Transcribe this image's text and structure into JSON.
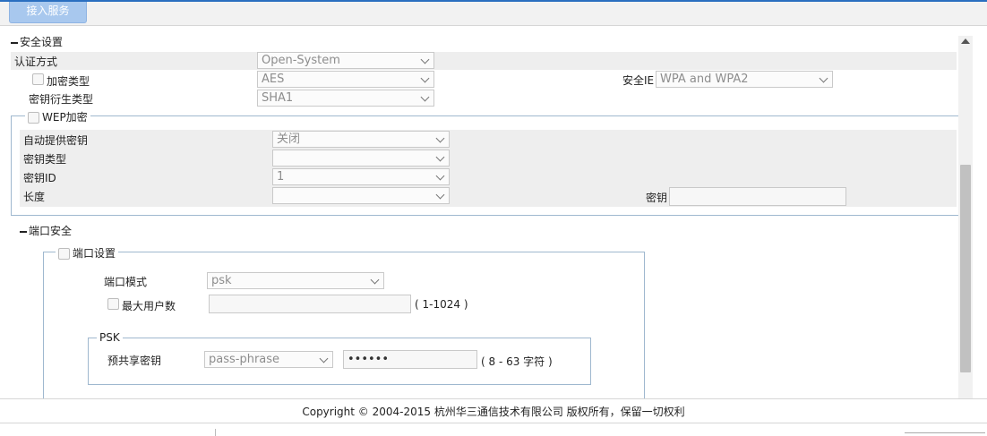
{
  "tab": {
    "label": "接入服务"
  },
  "security_settings": {
    "title": "安全设置",
    "auth_mode": {
      "label": "认证方式",
      "value": "Open-System"
    },
    "encrypt_type": {
      "label": "加密类型",
      "value": "AES"
    },
    "security_ie": {
      "label": "安全IE",
      "value": "WPA and WPA2"
    },
    "key_derivation": {
      "label": "密钥衍生类型",
      "value": "SHA1"
    }
  },
  "wep": {
    "legend": "WEP加密",
    "auto_key": {
      "label": "自动提供密钥",
      "value": "关闭"
    },
    "key_type": {
      "label": "密钥类型",
      "value": ""
    },
    "key_id": {
      "label": "密钥ID",
      "value": "1"
    },
    "length": {
      "label": "长度",
      "value": ""
    },
    "key": {
      "label": "密钥",
      "value": ""
    }
  },
  "port_security": {
    "title": "端口安全",
    "legend": "端口设置",
    "port_mode": {
      "label": "端口模式",
      "value": "psk"
    },
    "max_users": {
      "label": "最大用户数",
      "value": "",
      "range": "( 1-1024 )"
    },
    "psk": {
      "legend": "PSK",
      "preshared": {
        "label": "预共享密钥",
        "type": "pass-phrase",
        "value": "••••••",
        "range": "( 8 - 63 字符 )"
      }
    }
  },
  "footer": {
    "copyright": "Copyright © 2004-2015 杭州华三通信技术有限公司 版权所有，保留一切权利"
  }
}
